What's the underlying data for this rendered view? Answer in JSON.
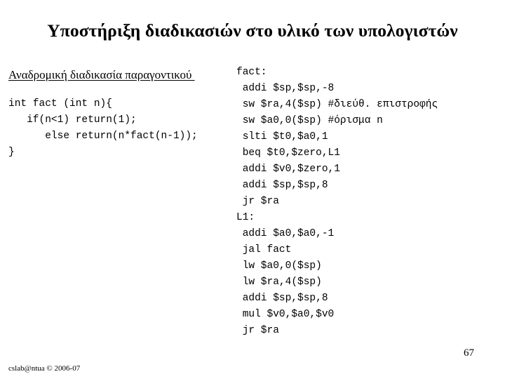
{
  "slide": {
    "title": "Υποστήριξη διαδικασιών στο υλικό των υπολογιστών",
    "page_number": "67",
    "footer": "cslab@ntua © 2006-07",
    "background_color": "#ffffff",
    "text_color": "#000000"
  },
  "left_column": {
    "heading": "Αναδρομική διαδικασία παραγοντικού ",
    "c_code": [
      "int fact (int n){",
      "   if(n<1) return(1);",
      "      else return(n*fact(n-1));",
      "}"
    ]
  },
  "right_column": {
    "asm_code": [
      "fact:",
      " addi $sp,$sp,-8",
      " sw $ra,4($sp) #διεύθ. επιστροφής",
      " sw $a0,0($sp) #όρισμα n",
      " slti $t0,$a0,1",
      " beq $t0,$zero,L1",
      " addi $v0,$zero,1",
      " addi $sp,$sp,8",
      " jr $ra",
      "L1:",
      " addi $a0,$a0,-1",
      " jal fact",
      " lw $a0,0($sp)",
      " lw $ra,4($sp)",
      " addi $sp,$sp,8",
      " mul $v0,$a0,$v0",
      " jr $ra"
    ]
  }
}
